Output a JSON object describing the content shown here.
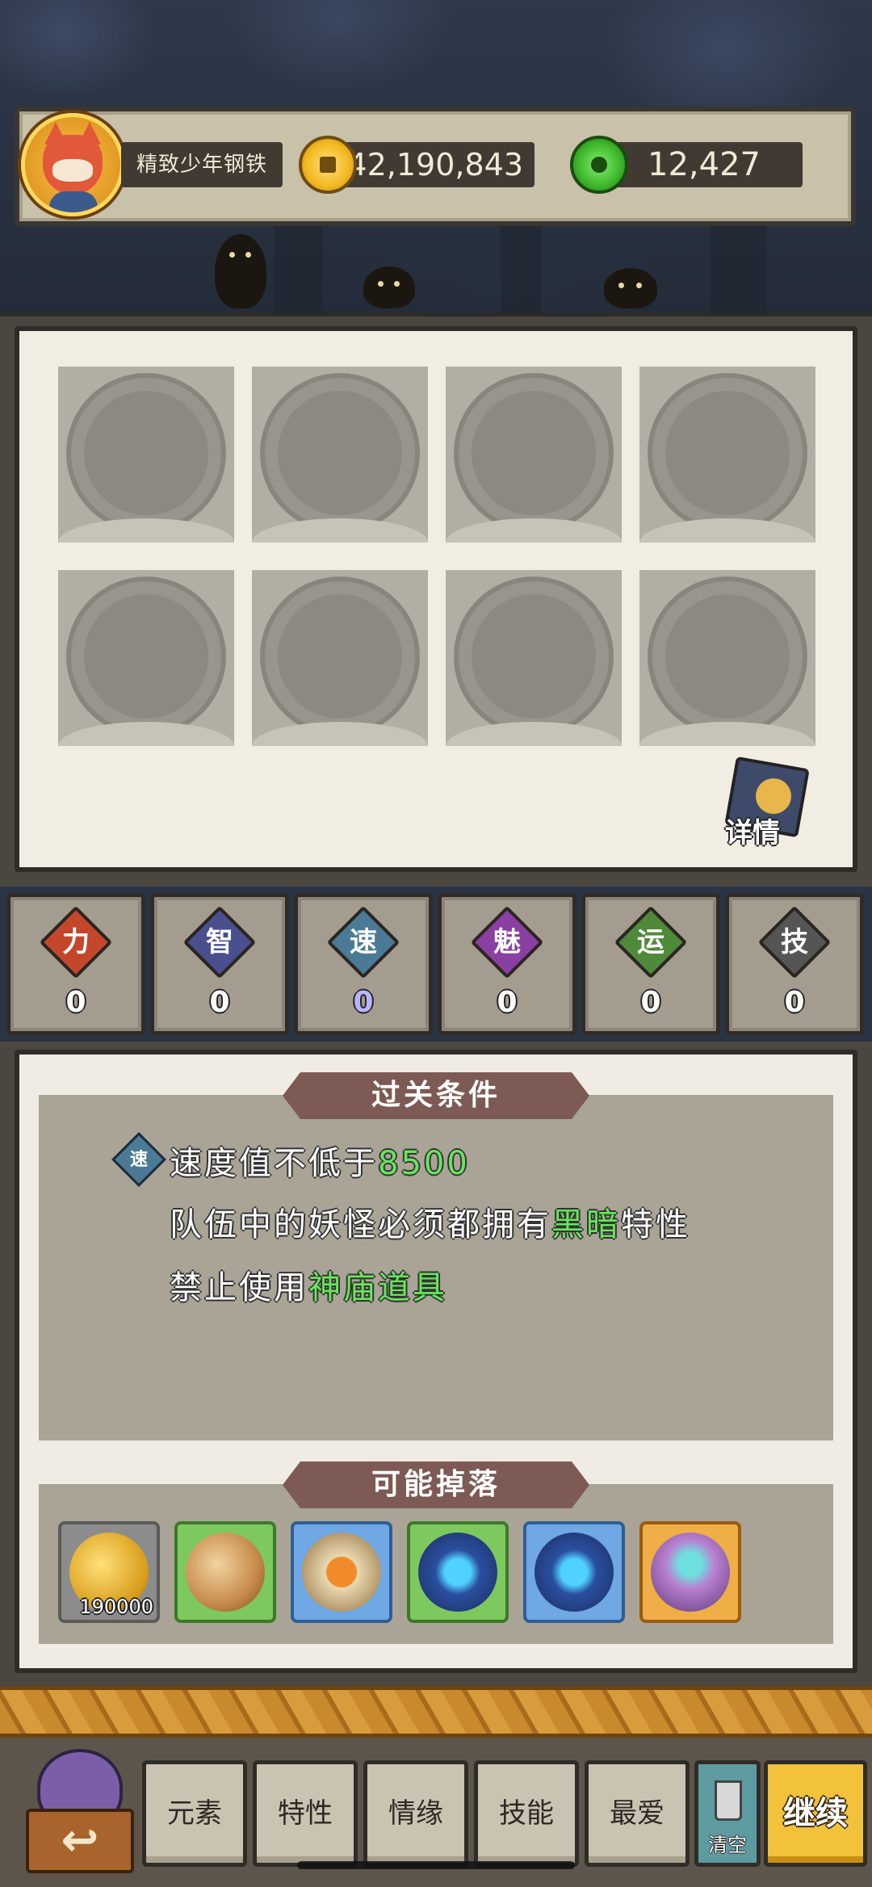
{
  "player": {
    "name": "精致少年钢铁",
    "coins": "42,190,843",
    "jade": "12,427"
  },
  "team": {
    "slot_count": 8,
    "detail_label": "详情"
  },
  "stats": [
    {
      "glyph": "力",
      "value": "0",
      "color": "#c4472b",
      "name": "strength"
    },
    {
      "glyph": "智",
      "value": "0",
      "color": "#4a4f8e",
      "name": "intellect"
    },
    {
      "glyph": "速",
      "value": "0",
      "color": "#4b7a96",
      "name": "speed"
    },
    {
      "glyph": "魅",
      "value": "0",
      "color": "#8a3fa3",
      "name": "charm"
    },
    {
      "glyph": "运",
      "value": "0",
      "color": "#4f8a3a",
      "name": "luck"
    },
    {
      "glyph": "技",
      "value": "0",
      "color": "#555555",
      "name": "skill"
    }
  ],
  "conditions": {
    "title": "过关条件",
    "badge": "速",
    "line1_prefix": "速度值不低于",
    "line1_value": "8500",
    "line2_prefix": "队伍中的妖怪必须都拥有",
    "line2_highlight": "黑暗",
    "line2_suffix": "特性",
    "line3_prefix": "禁止使用",
    "line3_highlight": "神庙道具"
  },
  "drops": {
    "title": "可能掉落",
    "items": [
      {
        "icon": "coin-stack-icon",
        "qty": "190000",
        "frame": "#5a5a5a"
      },
      {
        "icon": "triangle-rune-icon",
        "qty": "",
        "frame": "#5cae45"
      },
      {
        "icon": "amber-rune-icon",
        "qty": "",
        "frame": "#4c8fd4"
      },
      {
        "icon": "crystal-orb-icon",
        "qty": "",
        "frame": "#5cae45"
      },
      {
        "icon": "crystal-orb-icon",
        "qty": "",
        "frame": "#4c8fd4"
      },
      {
        "icon": "treasure-chest-icon",
        "qty": "",
        "frame": "#e39a2f"
      }
    ]
  },
  "bottom_nav": {
    "back_glyph": "↩",
    "tabs": [
      "元素",
      "特性",
      "情缘",
      "技能",
      "最爱"
    ],
    "clear_label": "清空",
    "continue_label": "继续"
  }
}
